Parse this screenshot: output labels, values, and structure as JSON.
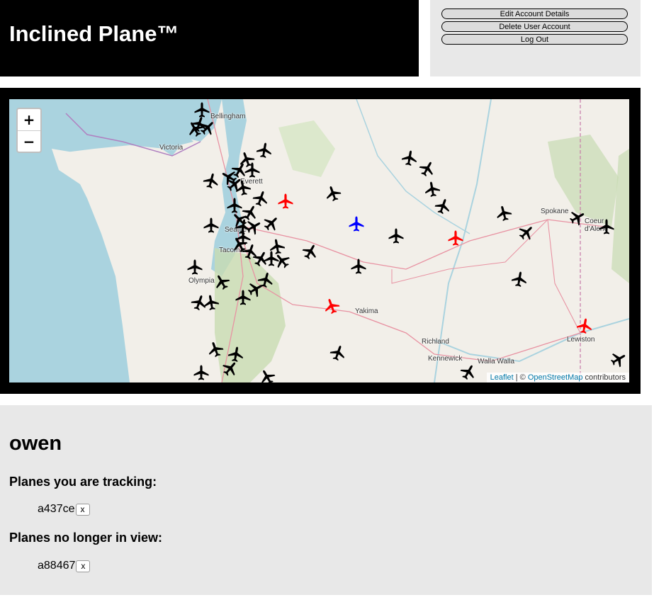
{
  "app": {
    "title": "Inclined Plane™"
  },
  "account": {
    "edit_label": "Edit Account Details",
    "delete_label": "Delete User Account",
    "logout_label": "Log Out"
  },
  "map": {
    "zoom_in": "+",
    "zoom_out": "−",
    "attribution": {
      "leaflet": "Leaflet",
      "sep": " | © ",
      "osm": "OpenStreetMap",
      "suffix": " contributors"
    },
    "places": [
      {
        "name": "Bellingham"
      },
      {
        "name": "Victoria"
      },
      {
        "name": "Everett"
      },
      {
        "name": "Seattle"
      },
      {
        "name": "Tacoma"
      },
      {
        "name": "Olympia"
      },
      {
        "name": "Spokane"
      },
      {
        "name": "Coeur d'Alene"
      },
      {
        "name": "Yakima"
      },
      {
        "name": "Richland"
      },
      {
        "name": "Kennewick"
      },
      {
        "name": "Walla Walla"
      },
      {
        "name": "Lewiston"
      }
    ],
    "plane_colors": {
      "default": "#000000",
      "tracked": "#ff0000",
      "selected": "#0000ff"
    }
  },
  "user": {
    "username": "owen",
    "tracking_heading": "Planes you are tracking:",
    "tracking": [
      {
        "id": "a437ce",
        "remove_label": "x"
      }
    ],
    "gone_heading": "Planes no longer in view:",
    "gone": [
      {
        "id": "a88467",
        "remove_label": "x"
      }
    ]
  }
}
